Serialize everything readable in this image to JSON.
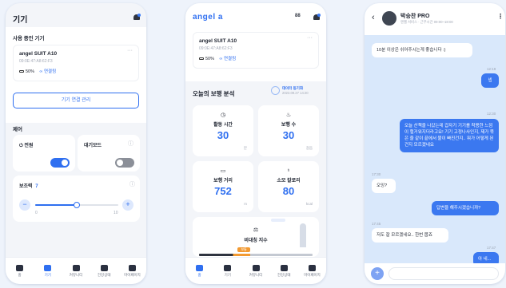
{
  "colors": {
    "accent": "#2f6ff0",
    "background": "#eef3fb"
  },
  "nav": [
    {
      "label": "홈",
      "icon": "home-icon"
    },
    {
      "label": "기기",
      "icon": "device-icon"
    },
    {
      "label": "커뮤니티",
      "icon": "community-icon"
    },
    {
      "label": "건강상태",
      "icon": "health-icon"
    },
    {
      "label": "마이페이지",
      "icon": "user-icon"
    }
  ],
  "screen1": {
    "title": "기기",
    "section_in_use": "사용 중인 기기",
    "device": {
      "name": "angel SUIT A10",
      "id": "09:0E:47:A8:62:F3",
      "battery": "50%",
      "status": "연결됨",
      "more": "···"
    },
    "manage_button": "기기 연결 관리",
    "section_control": "제어",
    "power_label": "전원",
    "standby_label": "대기모드",
    "assist_label": "보조력",
    "assist_value": "7",
    "slider_min": "0",
    "slider_max": "10",
    "slider_level": 0.5,
    "power_on": true,
    "standby_on": false
  },
  "screen2": {
    "logo": "angel a",
    "header_icons": [
      "88",
      "bell"
    ],
    "device": {
      "name": "angel SUIT A10",
      "id": "09:0E:47:A8:62:F3",
      "battery": "50%",
      "status": "연결됨",
      "more": "···"
    },
    "section_title": "오늘의 보행 분석",
    "sync_label": "데이터 동기화",
    "sync_time": "2023.09.27 14:20",
    "stats": [
      {
        "label": "활동 시간",
        "value": "30",
        "unit": "분"
      },
      {
        "label": "보행 수",
        "value": "30",
        "unit": "걸음"
      },
      {
        "label": "보행 거리",
        "value": "752",
        "unit": "m"
      },
      {
        "label": "소모 칼로리",
        "value": "80",
        "unit": "kcal"
      }
    ],
    "asymmetry_label": "비대칭 지수",
    "asymmetry_badge": "보통"
  },
  "screen3": {
    "contact_name": "박승찬 PRO",
    "contact_sub": "엔젤 서비스 · 근무시간 09:00~18:00",
    "messages": [
      {
        "side": "in",
        "text": "10분 이상은 쉬어주시는게 좋습니다 :)",
        "time": ""
      },
      {
        "side": "out",
        "text": "넵",
        "time": "12:19"
      },
      {
        "side": "out",
        "text": "오늘 산책을 나갔는데 갑자기 기기를 착용한 느낌이 헐거워지더라고요! 기기 고정나사인지, 제가 묶은 줄 같이 끝에서 불이 빠진건지.. 뭐가 어떻게 된건지 모르겠네요",
        "time": "12:30"
      },
      {
        "side": "in",
        "text": "오잉?",
        "time": "17:30"
      },
      {
        "side": "out",
        "text": "답변을 해주시겠습니까?",
        "time": ""
      },
      {
        "side": "in",
        "text": "저도 잘 모르겠네요.. 한번 봅죠",
        "time": "17:45"
      },
      {
        "side": "out",
        "text": "아 네...",
        "time": "17:47"
      }
    ],
    "input_placeholder": ""
  }
}
